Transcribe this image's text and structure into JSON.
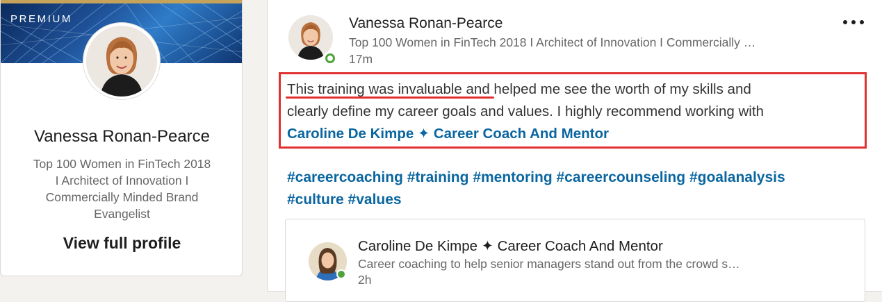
{
  "profile_card": {
    "badge": "PREMIUM",
    "name": "Vanessa Ronan-Pearce",
    "headline_lines": [
      "Top 100 Women in FinTech 2018",
      "I Architect of Innovation I",
      "Commercially Minded Brand",
      "Evangelist"
    ],
    "view_profile_label": "View full profile"
  },
  "post": {
    "author_name": "Vanessa Ronan-Pearce",
    "author_headline": "Top 100 Women in FinTech 2018 I Architect of Innovation I Commercially …",
    "time": "17m",
    "more_icon": "more-horizontal-icon",
    "text_line1": "This training was invaluable and helped me see the worth of my skills and",
    "text_line2": "clearly define my career goals and values. I highly recommend working with",
    "mention": "Caroline De Kimpe ✦ Career Coach And Mentor",
    "hashtags": [
      "#careercoaching",
      "#training",
      "#mentoring",
      "#careercounseling",
      "#goalanalysis",
      "#culture",
      "#values"
    ]
  },
  "shared": {
    "name": "Caroline De Kimpe ✦ Career Coach And Mentor",
    "description": "Career coaching to help senior managers stand out from the crowd s…",
    "time": "2h"
  },
  "colors": {
    "link": "#0a66a0",
    "highlight": "#e0312f",
    "online": "#4ea33b",
    "premium_gold": "#c6a35a"
  }
}
